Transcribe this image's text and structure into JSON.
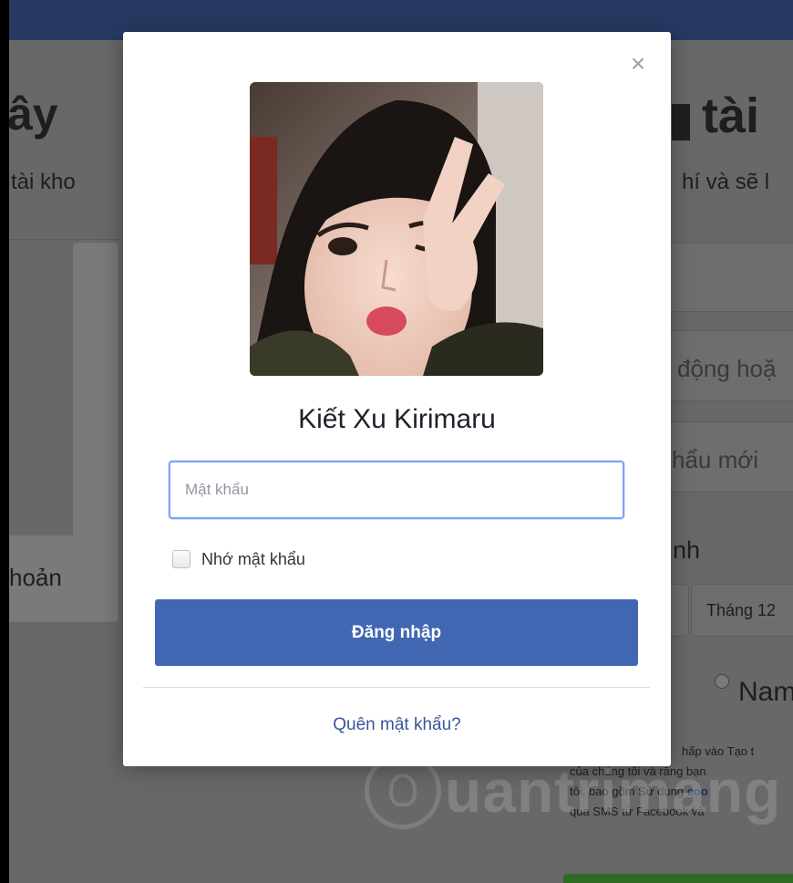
{
  "background": {
    "left_heading": "ây",
    "left_subtext": "tài kho",
    "left_card_label": "hoản",
    "right_heading": "tài",
    "right_subtext": "hí và sẽ l",
    "mobile_placeholder": "động hoặ",
    "new_password_placeholder": "hẩu mới",
    "birthday_label": "nh",
    "month_select_value": "Tháng 12",
    "gender_male_label": "Nam",
    "terms_line1": "hấp vào Tạo t",
    "terms_line2": "của chúng tôi và rằng bạn",
    "terms_line3_prefix": "tôi, bao gồm Sử dụng ",
    "terms_line3_link": "coo",
    "terms_line4": "qua SMS từ Facebook và",
    "watermark_text": "uantrimang"
  },
  "modal": {
    "close_glyph": "×",
    "user_name": "Kiết Xu Kirimaru",
    "password_placeholder": "Mật khẩu",
    "remember_label": "Nhớ mật khẩu",
    "login_button": "Đăng nhập",
    "forgot_link": "Quên mật khẩu?"
  },
  "colors": {
    "top_bar": "#3b5998",
    "login_button": "#4267b2",
    "link": "#365899",
    "input_focus_border": "#7ea3f5"
  },
  "icons": {
    "close": "close-icon",
    "checkbox": "checkbox-icon",
    "watermark_logo": "quantrimang-logo-icon"
  }
}
